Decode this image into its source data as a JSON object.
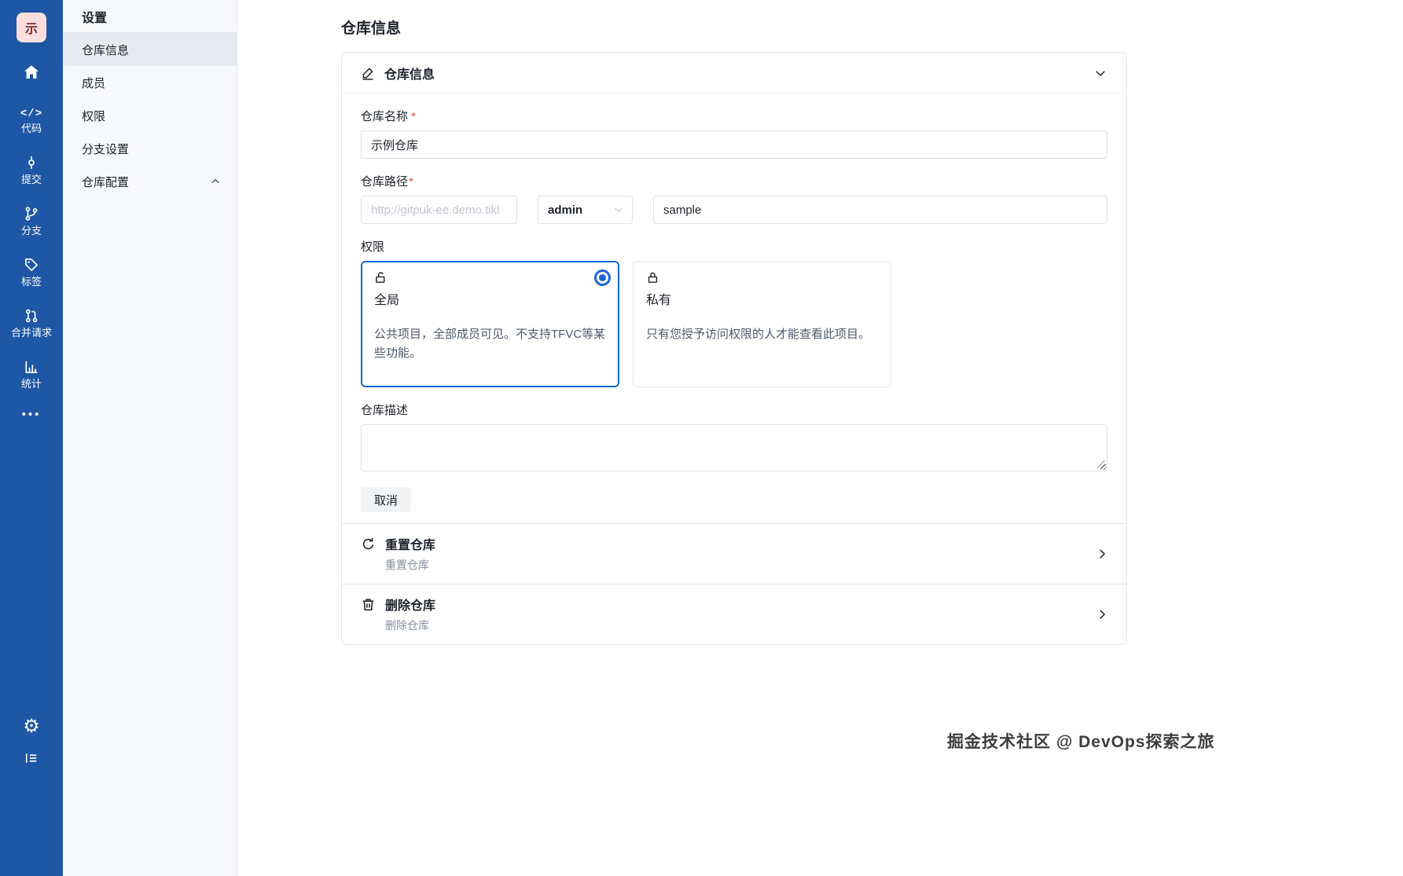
{
  "colors": {
    "sidebar_blue": "#1e57a6",
    "accent_blue": "#1a66d6",
    "required_red": "#f53f3f",
    "avatar_pink": "#fbdede"
  },
  "rail": {
    "avatar_text": "示",
    "nav": [
      {
        "label": "代码"
      },
      {
        "label": "提交"
      },
      {
        "label": "分支"
      },
      {
        "label": "标签"
      },
      {
        "label": "合并请求"
      },
      {
        "label": "统计"
      }
    ],
    "more_glyph": "•••",
    "gear_glyph": "⚙"
  },
  "settings_nav": {
    "title": "设置",
    "items": [
      {
        "label": "仓库信息"
      },
      {
        "label": "成员"
      },
      {
        "label": "权限"
      },
      {
        "label": "分支设置"
      },
      {
        "label": "仓库配置"
      }
    ]
  },
  "main": {
    "page_title": "仓库信息",
    "card_title": "仓库信息",
    "form": {
      "required_mark": "*",
      "name_label": "仓库名称",
      "name_value": "示例仓库",
      "path_label": "仓库路径",
      "base_url_placeholder": "http://gitpuk-ee.demo.tikl",
      "namespace_value": "admin",
      "repo_value": "sample",
      "permission_label": "权限",
      "description_label": "仓库描述",
      "cancel_label": "取消"
    },
    "permissions": [
      {
        "title": "全局",
        "desc": "公共项目，全部成员可见。不支持TFVC等某些功能。"
      },
      {
        "title": "私有",
        "desc": "只有您授予访问权限的人才能查看此项目。"
      }
    ],
    "actions": [
      {
        "title": "重置仓库",
        "subtitle": "重置仓库"
      },
      {
        "title": "删除仓库",
        "subtitle": "删除仓库"
      }
    ]
  },
  "watermark": "掘金技术社区 @ DevOps探索之旅"
}
